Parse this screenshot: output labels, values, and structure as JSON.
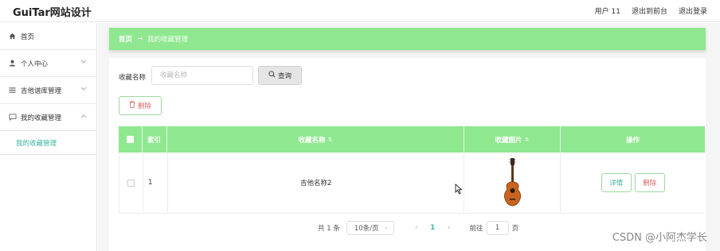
{
  "app": {
    "title": "GuiTar网站设计"
  },
  "header": {
    "user": "用户 11",
    "back_label": "退出到前台",
    "logout_label": "退出登录"
  },
  "sidebar": {
    "items": [
      {
        "label": "首页",
        "icon": "home-icon"
      },
      {
        "label": "个人中心",
        "icon": "user-icon",
        "expandable": true
      },
      {
        "label": "吉他谱库管理",
        "icon": "list-icon",
        "expandable": true
      },
      {
        "label": "我的收藏管理",
        "icon": "chat-icon",
        "expandable": true,
        "expanded": true
      }
    ],
    "submenu": {
      "label": "我的收藏管理",
      "active": true
    }
  },
  "breadcrumb": {
    "home": "首页",
    "separator": "→",
    "current": "我的收藏管理"
  },
  "search": {
    "label": "收藏名称",
    "placeholder": "收藏名称",
    "button_label": "查询"
  },
  "toolbar": {
    "delete_label": "删除"
  },
  "table": {
    "headers": {
      "index": "索引",
      "name": "收藏名称",
      "image": "收藏图片",
      "actions": "操作"
    },
    "rows": [
      {
        "index": "1",
        "name": "吉他名称2",
        "image": "guitar-image",
        "detail_label": "详情",
        "delete_label": "删除"
      }
    ]
  },
  "pagination": {
    "total": "共 1 条",
    "page_size": "10条/页",
    "current_page": "1",
    "goto_label": "前往",
    "goto_value": "1",
    "page_suffix": "页"
  },
  "watermark": "CSDN @小阿杰学长",
  "colors": {
    "accent_green": "#8fe88f",
    "teal": "#3bb5a0",
    "danger": "#e06666"
  }
}
